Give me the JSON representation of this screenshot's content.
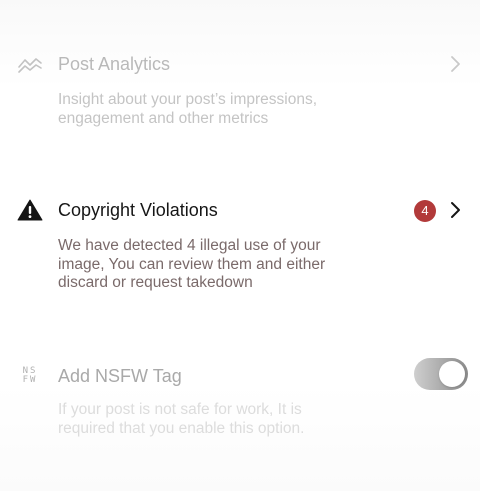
{
  "sections": {
    "post_analytics": {
      "icon": "analytics-trend-icon",
      "title": "Post Analytics",
      "description": "Insight about your post’s impressions, engagement and other metrics"
    },
    "copyright": {
      "icon": "warning-triangle-icon",
      "title": "Copyright Violations",
      "badge_count": "4",
      "description": "We have detected 4 illegal use of your image, You can review them and either discard or request takedown"
    },
    "nsfw": {
      "icon_text": "NSFW",
      "title": "Add NSFW Tag",
      "description": "If your post is not safe for work, It is required that you enable this option.",
      "toggle_on": true
    }
  },
  "colors": {
    "badge": "#b23a3a",
    "active_title": "#161616",
    "active_desc": "#7a6a6a"
  }
}
